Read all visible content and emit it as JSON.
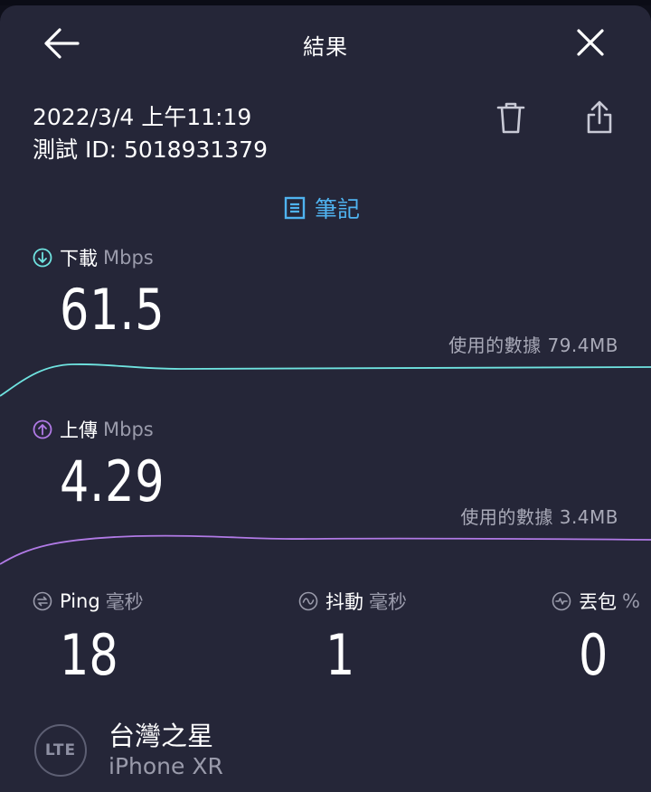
{
  "header": {
    "title": "結果",
    "back_icon": "arrow-left-icon",
    "close_icon": "close-icon"
  },
  "result": {
    "date": "2022/3/4 上午11:19",
    "test_id": "測試 ID: 5018931379",
    "actions": {
      "delete_icon": "trash-icon",
      "share_icon": "share-icon"
    },
    "notes_label": "筆記"
  },
  "download": {
    "label": "下載",
    "unit": "Mbps",
    "value": "61.5",
    "data_used": "使用的數據 79.4MB",
    "color": "#6fe3e0"
  },
  "upload": {
    "label": "上傳",
    "unit": "Mbps",
    "value": "4.29",
    "data_used": "使用的數據 3.4MB",
    "color": "#b17ae6"
  },
  "ping": {
    "label": "Ping",
    "unit": "毫秒",
    "value": "18"
  },
  "jitter": {
    "label": "抖動",
    "unit": "毫秒",
    "value": "1"
  },
  "loss": {
    "label": "丟包",
    "unit": "%",
    "value": "0"
  },
  "network": {
    "badge": "LTE",
    "carrier": "台灣之星",
    "device": "iPhone XR"
  },
  "colors": {
    "background": "#252638",
    "accent": "#4fb3f0",
    "muted": "#9a9bab"
  }
}
